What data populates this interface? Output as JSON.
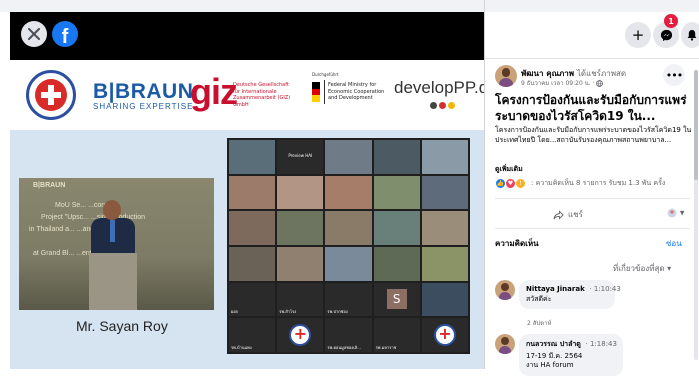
{
  "viewer": {
    "close_icon": "close-icon",
    "facebook_logo": "f",
    "logos": {
      "bbraun_name": "B|BRAUN",
      "bbraun_tagline": "SHARING EXPERTISE",
      "giz_name": "giz",
      "giz_description": "Deutsche Gesellschaft für Internationale Zusammenarbeit (GIZ) GmbH",
      "bmz_label": "Durchgeführt",
      "bmz_text": "Federal Ministry for Economic Cooperation and Development",
      "developpp": "developPP.de"
    },
    "left_video_lines": [
      "B|BRAUN",
      "MoU Se... ...conomy",
      "Project \"Upsc... ...sing Production",
      "in Thailand a... ...and Hygiene\"",
      "at Grand Bl... ...ention Hotel"
    ],
    "speaker_name": "Mr. Sayan Roy",
    "grid_tiles": [
      {
        "label": "",
        "text": "",
        "color": "#5a6e7a"
      },
      {
        "label": "",
        "text": "Preview HAI",
        "color": "#2a2a2a"
      },
      {
        "label": "",
        "text": "",
        "color": "#6f7c88"
      },
      {
        "label": "",
        "text": "",
        "color": "#4b5a63"
      },
      {
        "label": "",
        "text": "",
        "color": "#8a9aa6"
      },
      {
        "label": "",
        "text": "",
        "color": "#9c7b6a"
      },
      {
        "label": "",
        "text": "",
        "color": "#b39585"
      },
      {
        "label": "",
        "text": "",
        "color": "#a67d68"
      },
      {
        "label": "",
        "text": "",
        "color": "#7f8f6e"
      },
      {
        "label": "",
        "text": "",
        "color": "#5d6b7a"
      },
      {
        "label": "",
        "text": "",
        "color": "#7e6a5c"
      },
      {
        "label": "",
        "text": "",
        "color": "#6d7560"
      },
      {
        "label": "",
        "text": "",
        "color": "#8a7a68"
      },
      {
        "label": "",
        "text": "",
        "color": "#687f7a"
      },
      {
        "label": "",
        "text": "",
        "color": "#9a8d7a"
      },
      {
        "label": "",
        "text": "",
        "color": "#6a6257"
      },
      {
        "label": "",
        "text": "",
        "color": "#8f806f"
      },
      {
        "label": "",
        "text": "",
        "color": "#7a8a9a"
      },
      {
        "label": "",
        "text": "",
        "color": "#5e6a55"
      },
      {
        "label": "",
        "text": "",
        "color": "#8b9467"
      },
      {
        "label": "ผอก",
        "text": "",
        "color": "#2a2a2a"
      },
      {
        "label": "รพ.สำโรง",
        "text": "",
        "color": "#2a2a2a"
      },
      {
        "label": "รพ.ปากช่อง",
        "text": "",
        "color": "#2a2a2a"
      },
      {
        "label": "",
        "text": "",
        "color": "#2a2a2a",
        "initial": "S"
      },
      {
        "label": "",
        "text": "",
        "color": "#3b4d5e"
      },
      {
        "label": "รพ.บ้านแพง",
        "text": "",
        "color": "#2a2a2a"
      },
      {
        "label": "",
        "text": "",
        "color": "#2a2a2a",
        "logo": true
      },
      {
        "label": "รพ.ดอนมูลชองเลิ...",
        "text": "",
        "color": "#2a2a2a"
      },
      {
        "label": "รพ.มหาราช",
        "text": "",
        "color": "#2a2a2a"
      },
      {
        "label": "",
        "text": "",
        "color": "#2a2a2a",
        "logo": true
      }
    ]
  },
  "header": {
    "add_icon": "+",
    "messenger_badge": "1"
  },
  "post": {
    "author": "พัฒนา คุณภาพ",
    "author_tag": "ได้แชร์ภาพสด",
    "meta": "9 ธันวาคม เวลา 09:20 น. · ",
    "more": "•••",
    "title": "โครงการป้องกันและรับมือกับการแพร่ระบาดของไวรัสโควิด19 ใน...",
    "body": "โครงการป้องกันและรับมือกับการแพร่ระบาดของไวรัสโควิด19 ในประเทศไทยปี โดย...สถาบันรับรองคุณภาพสถานพยาบาล...",
    "see_more": "ดูเพิ่มเติม",
    "reactions_text": ": ความคิดเห็น 8 รายการ รับชม 1.3 พัน ครั้ง",
    "share_label": "แชร์",
    "audience_label": "▾"
  },
  "comments": {
    "heading": "ความคิดเห็น",
    "hide": "ซ่อน",
    "sort": "ที่เกี่ยวข้องที่สุด ▾",
    "items": [
      {
        "name": "Nittaya Jinarak",
        "time": "1:10:43",
        "text": "สวัสดีค่ะ",
        "age": "2 สัปดาห์"
      },
      {
        "name": "กนลวรรณ ปาลำดู",
        "time": "1:18:43",
        "text": "17-19 มี.ค. 2564\nงาน HA forum",
        "age": ""
      }
    ]
  },
  "colors": {
    "facebook_blue": "#1877f2",
    "badge_red": "#e41e3f",
    "giz_red": "#c8102e",
    "bbraun_blue": "#1b5aa6"
  }
}
